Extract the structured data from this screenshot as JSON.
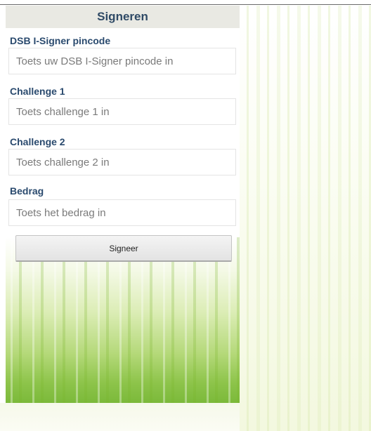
{
  "header": {
    "title": "Signeren"
  },
  "form": {
    "pincode": {
      "label": "DSB I-Signer pincode",
      "placeholder": "Toets uw DSB I-Signer pincode in",
      "value": ""
    },
    "challenge1": {
      "label": "Challenge 1",
      "placeholder": "Toets challenge 1 in",
      "value": ""
    },
    "challenge2": {
      "label": "Challenge 2",
      "placeholder": "Toets challenge 2 in",
      "value": ""
    },
    "amount": {
      "label": "Bedrag",
      "placeholder": "Toets het bedrag in",
      "value": ""
    },
    "submit_label": "Signeer"
  },
  "colors": {
    "title_text": "#2f4a66",
    "label_text": "#2a4a6e",
    "title_bar": "#e9e9e3",
    "grass_green": "#7bb93a"
  }
}
